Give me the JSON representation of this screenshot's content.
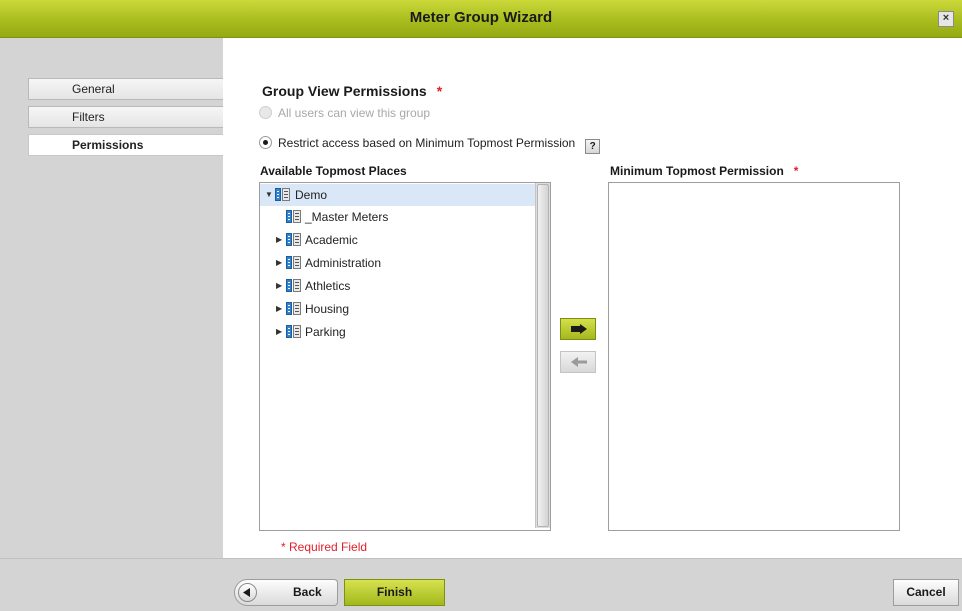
{
  "window": {
    "title": "Meter Group Wizard",
    "close_glyph": "×"
  },
  "sidebar": {
    "items": [
      {
        "label": "General",
        "active": false
      },
      {
        "label": "Filters",
        "active": false
      },
      {
        "label": "Permissions",
        "active": true
      }
    ]
  },
  "permissions": {
    "heading": "Group View Permissions",
    "required_marker": "*",
    "option_all_users": "All users can view this group",
    "option_restrict": "Restrict access based on Minimum Topmost Permission",
    "help_label": "?",
    "available_label": "Available Topmost Places",
    "minimum_label": "Minimum Topmost Permission",
    "required_note": "* Required Field"
  },
  "tree": [
    {
      "label": "Demo",
      "expander": "expanded",
      "selected": true,
      "icon": "building-icon"
    },
    {
      "label": "_Master Meters",
      "expander": "none",
      "selected": false,
      "icon": "building-icon"
    },
    {
      "label": "Academic",
      "expander": "collapsed",
      "selected": false,
      "icon": "building-icon"
    },
    {
      "label": "Administration",
      "expander": "collapsed",
      "selected": false,
      "icon": "building-icon"
    },
    {
      "label": "Athletics",
      "expander": "collapsed",
      "selected": false,
      "icon": "building-icon"
    },
    {
      "label": "Housing",
      "expander": "collapsed",
      "selected": false,
      "icon": "building-icon"
    },
    {
      "label": "Parking",
      "expander": "collapsed",
      "selected": false,
      "icon": "building-icon"
    }
  ],
  "footer": {
    "back_label": "Back",
    "finish_label": "Finish",
    "cancel_label": "Cancel"
  },
  "colors": {
    "accent": "#a9bd1e",
    "required": "#e0202a",
    "selection": "#d9e7f7"
  }
}
